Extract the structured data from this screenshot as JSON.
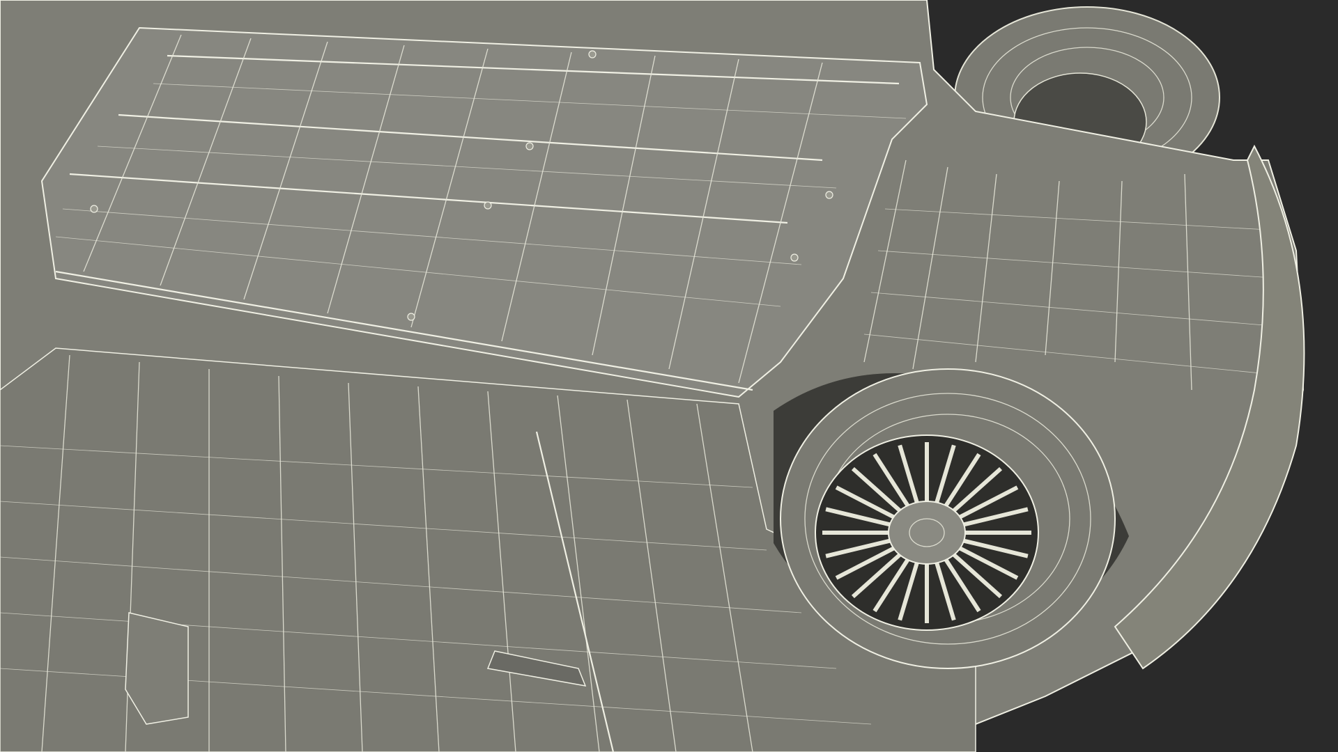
{
  "scene": {
    "colors": {
      "background": "#2a2a2a",
      "body": "#7e7e76",
      "body_light": "#8a8a82",
      "body_dark": "#6a6a64",
      "wire": "#e6e6d8",
      "shadow": "#3c3c38",
      "tire": "#7a7a72",
      "tire_dark": "#55554f"
    }
  }
}
